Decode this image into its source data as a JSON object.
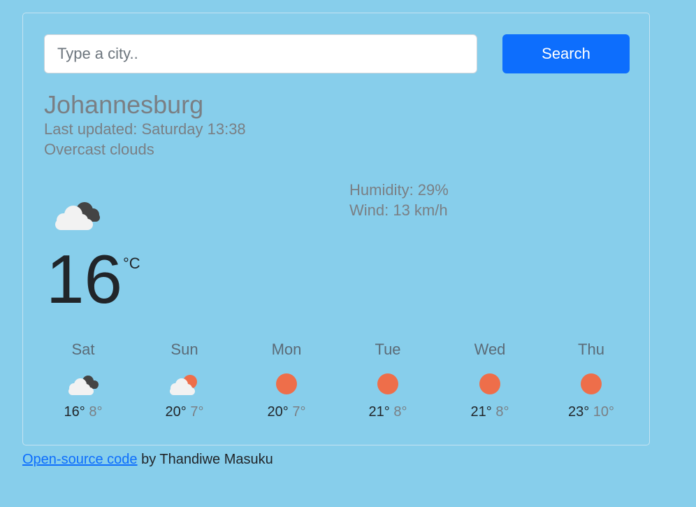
{
  "search": {
    "placeholder": "Type a city..",
    "button_label": "Search"
  },
  "current": {
    "city": "Johannesburg",
    "last_updated": "Last updated: Saturday 13:38",
    "description": "Overcast clouds",
    "icon": "overcast-clouds-icon",
    "temperature": "16",
    "unit": "°C",
    "humidity": "Humidity: 29%",
    "wind": "Wind: 13 km/h"
  },
  "forecast": [
    {
      "day": "Sat",
      "max": "16°",
      "min": "8°",
      "icon": "overcast-clouds-icon"
    },
    {
      "day": "Sun",
      "max": "20°",
      "min": "7°",
      "icon": "partly-cloudy-icon"
    },
    {
      "day": "Mon",
      "max": "20°",
      "min": "7°",
      "icon": "sun-icon"
    },
    {
      "day": "Tue",
      "max": "21°",
      "min": "8°",
      "icon": "sun-icon"
    },
    {
      "day": "Wed",
      "max": "21°",
      "min": "8°",
      "icon": "sun-icon"
    },
    {
      "day": "Thu",
      "max": "23°",
      "min": "10°",
      "icon": "sun-icon"
    }
  ],
  "footer": {
    "link_text": "Open-source code",
    "byline": "by Thandiwe Masuku"
  },
  "colors": {
    "background": "#87ceeb",
    "accent": "#0d6efd",
    "sun": "#ee6e4a",
    "cloud_light": "#f2f2f2",
    "cloud_dark": "#444444"
  }
}
